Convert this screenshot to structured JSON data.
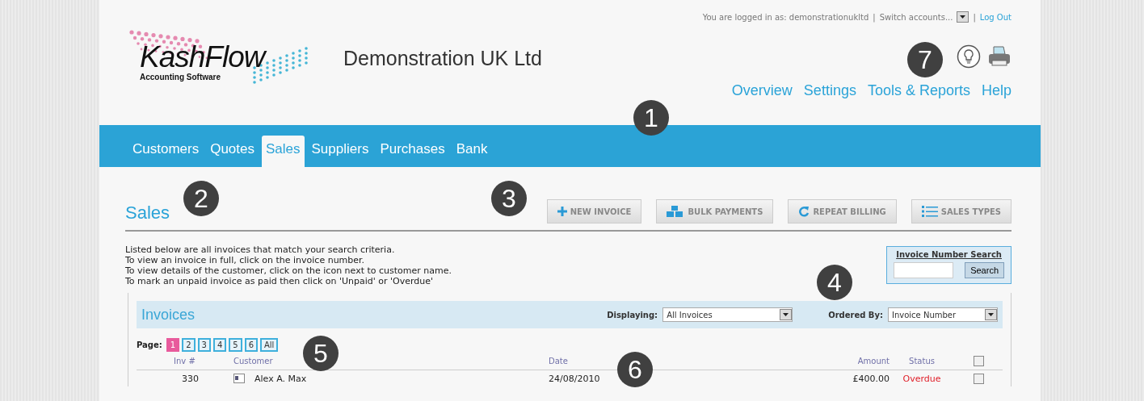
{
  "account_bar": {
    "logged_in": "You are logged in as: demonstrationukltd",
    "separator": "|",
    "switch_accounts": "Switch accounts...",
    "log_out": "Log Out"
  },
  "logo": {
    "name": "KashFlow",
    "tagline": "Accounting Software"
  },
  "company": "Demonstration UK Ltd",
  "top_links": [
    "Overview",
    "Settings",
    "Tools & Reports",
    "Help"
  ],
  "tabs": [
    {
      "label": "Customers",
      "selected": false
    },
    {
      "label": "Quotes",
      "selected": false
    },
    {
      "label": "Sales",
      "selected": true
    },
    {
      "label": "Suppliers",
      "selected": false
    },
    {
      "label": "Purchases",
      "selected": false
    },
    {
      "label": "Bank",
      "selected": false
    }
  ],
  "page_title": "Sales",
  "actions": [
    {
      "label": "NEW INVOICE",
      "kind": "plus"
    },
    {
      "label": "BULK PAYMENTS",
      "kind": "blocks"
    },
    {
      "label": "REPEAT BILLING",
      "kind": "repeat"
    },
    {
      "label": "SALES TYPES",
      "kind": "list"
    }
  ],
  "instructions": [
    "Listed below are all invoices that match your search criteria.",
    "To view an invoice in full, click on the invoice number.",
    "To view details of the customer, click on the icon next to customer name.",
    "To mark an unpaid invoice as paid then click on 'Unpaid' or 'Overdue'"
  ],
  "invoice_search": {
    "title": "Invoice Number Search",
    "button": "Search"
  },
  "invoices": {
    "title": "Invoices",
    "displaying_label": "Displaying:",
    "displaying_value": "All Invoices",
    "ordered_label": "Ordered By:",
    "ordered_value": "Invoice Number",
    "page_label": "Page:",
    "pages": [
      {
        "label": "1",
        "selected": true
      },
      {
        "label": "2",
        "selected": false
      },
      {
        "label": "3",
        "selected": false
      },
      {
        "label": "4",
        "selected": false
      },
      {
        "label": "5",
        "selected": false
      },
      {
        "label": "6",
        "selected": false
      },
      {
        "label": "All",
        "selected": false
      }
    ],
    "columns": [
      "Inv #",
      "Customer",
      "Date",
      "Amount",
      "Status"
    ],
    "select_all_checked": false,
    "rows": [
      {
        "inv": "330",
        "customer": "Alex A. Max",
        "date": "24/08/2010",
        "amount": "£400.00",
        "status": "Overdue",
        "checked": false
      }
    ]
  },
  "callouts": {
    "icons": "7",
    "nav": "1",
    "title": "2",
    "actions": "3",
    "filters": "4",
    "pages": "5",
    "columns": "6"
  }
}
